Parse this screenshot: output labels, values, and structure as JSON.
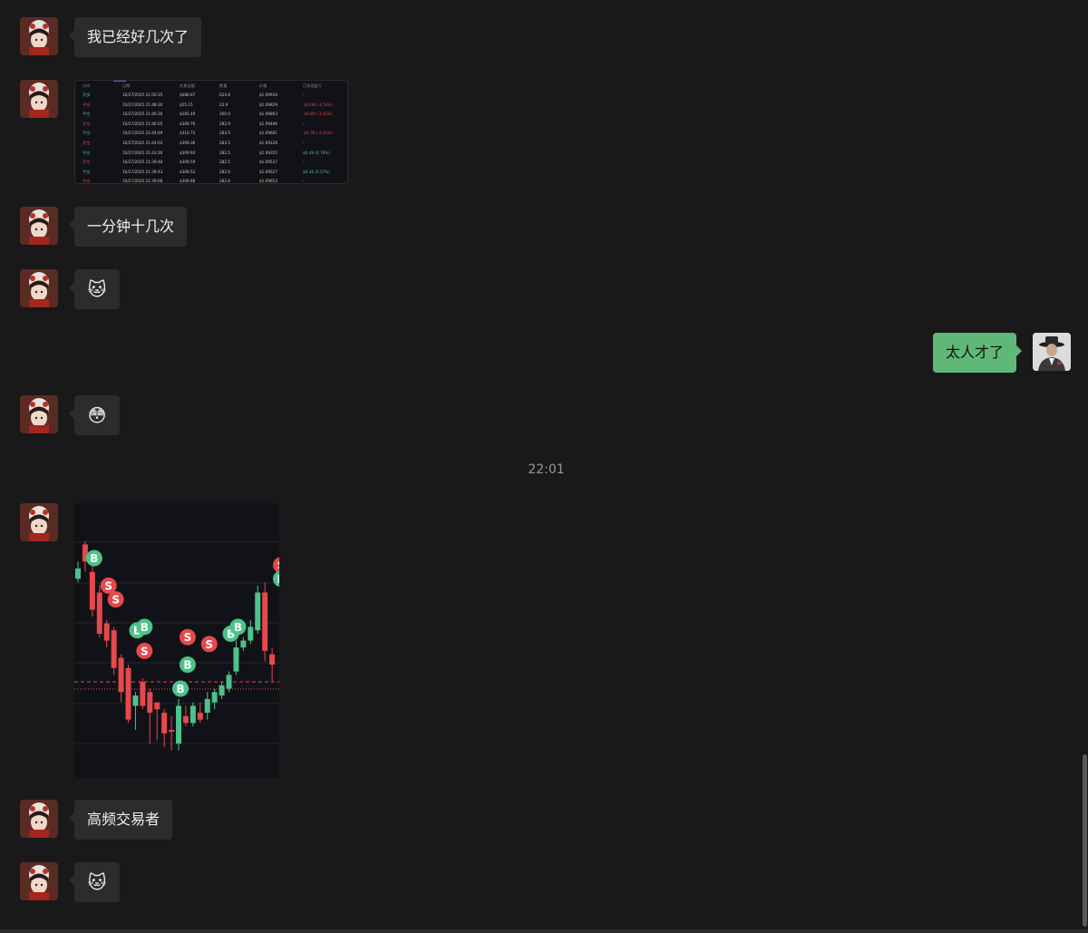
{
  "messages": [
    {
      "text": "我已经好几次了"
    },
    {
      "text": "一分钟十几次"
    },
    {
      "emoji": "🐱"
    },
    {
      "text": "太人才了"
    },
    {
      "emoji": "😳"
    },
    {
      "text": "高频交易者"
    },
    {
      "emoji": "🐱"
    }
  ],
  "timestamp": "22:01",
  "trade_table": {
    "headers": [
      "方向",
      "日期",
      "交易金额",
      "数量",
      "价格",
      "已实现盈亏"
    ],
    "rows": [
      {
        "side": "开多",
        "time": "10/27/2025 21:50:35",
        "amount": "$686.87",
        "qty": "624.8",
        "price": "$1.09934",
        "pnl": "-",
        "side_color": "g",
        "pnl_color": ""
      },
      {
        "side": "平空",
        "time": "10/27/2025 21:48:30",
        "amount": "$25.15",
        "qty": "22.9",
        "price": "$1.09829",
        "pnl": "-$0.08 (-1.53%)",
        "side_color": "r",
        "pnl_color": "r"
      },
      {
        "side": "平空",
        "time": "10/27/2025 21:46:30",
        "amount": "$285.49",
        "qty": "260.0",
        "price": "$1.09803",
        "pnl": "-$0.80 (-1.41%)",
        "side_color": "g",
        "pnl_color": "r"
      },
      {
        "side": "开空",
        "time": "10/27/2025 21:46:05",
        "amount": "$309.76",
        "qty": "282.9",
        "price": "$1.09496",
        "pnl": "-",
        "side_color": "r",
        "pnl_color": ""
      },
      {
        "side": "平空",
        "time": "10/27/2025 21:44:49",
        "amount": "$310.72",
        "qty": "283.5",
        "price": "$1.09601",
        "pnl": "-$1.30 (-2.21%)",
        "side_color": "g",
        "pnl_color": "r"
      },
      {
        "side": "开空",
        "time": "10/27/2025 21:44:03",
        "amount": "$309.36",
        "qty": "283.5",
        "price": "$1.09120",
        "pnl": "-",
        "side_color": "r",
        "pnl_color": ""
      },
      {
        "side": "平空",
        "time": "10/27/2025 21:43:26",
        "amount": "$309.93",
        "qty": "282.5",
        "price": "$1.09355",
        "pnl": "$0.49 (0.78%)",
        "side_color": "g",
        "pnl_color": "g"
      },
      {
        "side": "开空",
        "time": "10/27/2025 21:39:48",
        "amount": "$309.59",
        "qty": "282.5",
        "price": "$1.09537",
        "pnl": "-",
        "side_color": "r",
        "pnl_color": ""
      },
      {
        "side": "平空",
        "time": "10/27/2025 21:39:43",
        "amount": "$309.52",
        "qty": "282.6",
        "price": "$1.09527",
        "pnl": "$0.36 (0.57%)",
        "side_color": "g",
        "pnl_color": "g"
      },
      {
        "side": "开空",
        "time": "10/27/2025 21:39:08",
        "amount": "$309.88",
        "qty": "282.6",
        "price": "$1.09653",
        "pnl": "-",
        "side_color": "r",
        "pnl_color": ""
      }
    ]
  },
  "candle_chart": {
    "colors": {
      "up": "#4cc38a",
      "down": "#e5484d",
      "bg": "#111217",
      "grid": "#23252c"
    },
    "candles": [
      {
        "o": 62,
        "c": 59,
        "h": 57,
        "l": 63
      },
      {
        "o": 52,
        "c": 57,
        "h": 51,
        "l": 60
      },
      {
        "o": 60,
        "c": 71,
        "h": 58,
        "l": 73
      },
      {
        "o": 66,
        "c": 78,
        "h": 64,
        "l": 79
      },
      {
        "o": 75,
        "c": 80,
        "h": 74,
        "l": 82
      },
      {
        "o": 77,
        "c": 88,
        "h": 76,
        "l": 90
      },
      {
        "o": 85,
        "c": 95,
        "h": 84,
        "l": 98
      },
      {
        "o": 88,
        "c": 103,
        "h": 87,
        "l": 104
      },
      {
        "o": 99,
        "c": 96,
        "h": 95,
        "l": 106
      },
      {
        "o": 92,
        "c": 99,
        "h": 91,
        "l": 100
      },
      {
        "o": 95,
        "c": 101,
        "h": 94,
        "l": 110
      },
      {
        "o": 98,
        "c": 100,
        "h": 99,
        "l": 109
      },
      {
        "o": 101,
        "c": 107,
        "h": 100,
        "l": 111
      },
      {
        "o": 106,
        "c": 106,
        "h": 102,
        "l": 112
      },
      {
        "o": 110,
        "c": 99,
        "h": 97,
        "l": 112
      },
      {
        "o": 102,
        "c": 104,
        "h": 99,
        "l": 105
      },
      {
        "o": 104,
        "c": 99,
        "h": 98,
        "l": 105
      },
      {
        "o": 101,
        "c": 103,
        "h": 98,
        "l": 104
      },
      {
        "o": 101,
        "c": 97,
        "h": 95,
        "l": 103
      },
      {
        "o": 98,
        "c": 95,
        "h": 94,
        "l": 100
      },
      {
        "o": 96,
        "c": 93,
        "h": 92,
        "l": 97
      },
      {
        "o": 94,
        "c": 90,
        "h": 89,
        "l": 95
      },
      {
        "o": 89,
        "c": 82,
        "h": 80,
        "l": 90
      },
      {
        "o": 82,
        "c": 80,
        "h": 79,
        "l": 83
      },
      {
        "o": 80,
        "c": 76,
        "h": 74,
        "l": 81
      },
      {
        "o": 77,
        "c": 66,
        "h": 64,
        "l": 78
      },
      {
        "o": 66,
        "c": 83,
        "h": 63,
        "l": 86
      },
      {
        "o": 84,
        "c": 87,
        "h": 82,
        "l": 92
      }
    ],
    "markers": [
      {
        "label": "B",
        "i": 2,
        "v": 56
      },
      {
        "label": "S",
        "i": 4,
        "v": 64
      },
      {
        "label": "S",
        "i": 5,
        "v": 68
      },
      {
        "label": "B",
        "i": 8,
        "v": 77
      },
      {
        "label": "B",
        "i": 9,
        "v": 76
      },
      {
        "label": "S",
        "i": 9,
        "v": 83
      },
      {
        "label": "B",
        "i": 14,
        "v": 94
      },
      {
        "label": "B",
        "i": 15,
        "v": 87
      },
      {
        "label": "S",
        "i": 15,
        "v": 79
      },
      {
        "label": "S",
        "i": 18,
        "v": 81
      },
      {
        "label": "B",
        "i": 21,
        "v": 78
      },
      {
        "label": "B",
        "i": 22,
        "v": 76
      },
      {
        "label": "S",
        "i": 28,
        "v": 58
      },
      {
        "label": "B",
        "i": 28,
        "v": 62
      }
    ]
  }
}
